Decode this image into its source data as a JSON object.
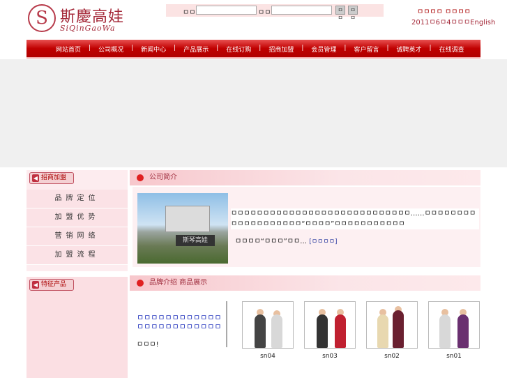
{
  "logo": {
    "mark": "S",
    "name": "斯慶高娃",
    "pinyin": "SiQinGaoWa"
  },
  "search": {
    "label1": "ㅁㅁㅁ",
    "label2": "ㅁㅁ",
    "btn1": "ㅁㅁ",
    "btn2": "ㅁㅁ"
  },
  "toplinks": "ㅁㅁㅁㅁ ㅁㅁㅁㅁ",
  "dateline": "2011ㅁ6ㅁ4ㅁㅁㅁEnglish",
  "nav": [
    "网站首页",
    "公司概况",
    "新闻中心",
    "产品展示",
    "在线订购",
    "招商加盟",
    "会员管理",
    "客户留言",
    "诚聘英才",
    "在线调查"
  ],
  "nav_sep": "|",
  "left1": {
    "heading": "招商加盟",
    "items": [
      "品牌定位",
      "加盟优势",
      "营销网络",
      "加盟流程"
    ]
  },
  "left2": {
    "heading": "特征产品"
  },
  "company": {
    "heading": "公司简介",
    "img_sign": "斯琴高娃",
    "text": "ㅁㅁㅁㅁㅁㅁㅁㅁㅁㅁㅁㅁㅁㅁㅁㅁㅁㅁㅁㅁㅁㅁㅁㅁㅁㅁㅁㅁ……ㅁㅁㅁㅁㅁㅁㅁㅁㅁㅁㅁㅁㅁㅁㅁㅁㅁㅁㅁ“ㅁㅁㅁㅁ”ㅁㅁㅁㅁㅁㅁㅁㅁㅁㅁㅁ",
    "more_text": "ㅁㅁㅁㅁ“ㅁㅁㅁ”ㅁㅁ…",
    "more_link": "[ㅁㅁㅁㅁ]"
  },
  "products": {
    "heading": "品牌介绍 商品展示",
    "news_link": "ㅁㅁㅁㅁㅁㅁㅁㅁㅁㅁㅁㅁㅁㅁㅁㅁㅁㅁㅁㅁㅁㅁㅁㅁ",
    "news_text": "ㅁㅁㅁ!",
    "items": [
      {
        "code": "sn04"
      },
      {
        "code": "sn03"
      },
      {
        "code": "sn02"
      },
      {
        "code": "sn01"
      }
    ]
  }
}
